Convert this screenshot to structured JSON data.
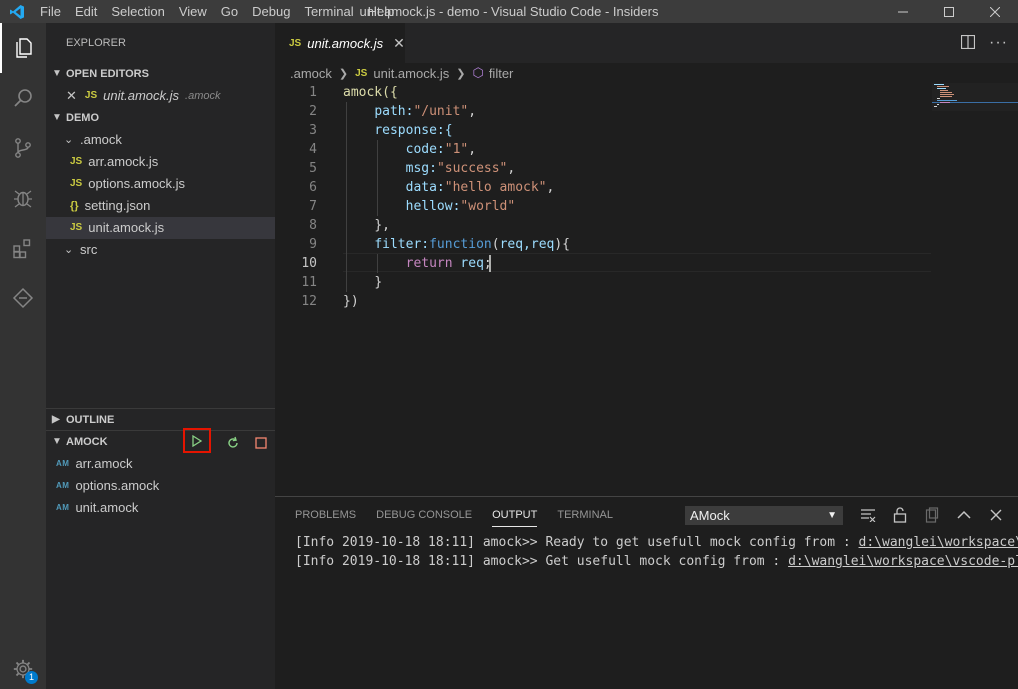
{
  "titlebar": {
    "menu": [
      "File",
      "Edit",
      "Selection",
      "View",
      "Go",
      "Debug",
      "Terminal",
      "Help"
    ],
    "window_title": "unit.amock.js - demo - Visual Studio Code - Insiders"
  },
  "activitybar": {
    "settings_badge": "1"
  },
  "sidebar": {
    "title": "EXPLORER",
    "open_editors": {
      "header": "OPEN EDITORS",
      "items": [
        {
          "icon": "JS",
          "name": "unit.amock.js",
          "path": ".amock"
        }
      ]
    },
    "demo": {
      "header": "DEMO",
      "folder": ".amock",
      "files": [
        {
          "icon": "JS",
          "name": "arr.amock.js"
        },
        {
          "icon": "JS",
          "name": "options.amock.js"
        },
        {
          "icon": "{}",
          "name": "setting.json"
        },
        {
          "icon": "JS",
          "name": "unit.amock.js"
        }
      ],
      "folder2": "src"
    },
    "outline": {
      "header": "OUTLINE"
    },
    "amock": {
      "header": "AMOCK",
      "items": [
        {
          "icon": "AM",
          "name": "arr.amock"
        },
        {
          "icon": "AM",
          "name": "options.amock"
        },
        {
          "icon": "AM",
          "name": "unit.amock"
        }
      ]
    }
  },
  "editor": {
    "tab": {
      "icon": "JS",
      "label": "unit.amock.js"
    },
    "breadcrumb": [
      ".amock",
      "unit.amock.js",
      "filter"
    ],
    "breadcrumb_icon": "JS",
    "line_numbers": [
      "1",
      "2",
      "3",
      "4",
      "5",
      "6",
      "7",
      "8",
      "9",
      "10",
      "11",
      "12"
    ],
    "current_line": "10",
    "code": {
      "l1": "amock({",
      "l2_key": "path:",
      "l2_val": "\"/unit\"",
      "l2_end": ",",
      "l3": "response:{",
      "l4_key": "code:",
      "l4_val": "\"1\"",
      "l4_end": ",",
      "l5_key": "msg:",
      "l5_val": "\"success\"",
      "l5_end": ",",
      "l6_key": "data:",
      "l6_val": "\"hello amock\"",
      "l6_end": ",",
      "l7_key": "hellow:",
      "l7_val": "\"world\"",
      "l8": "},",
      "l9_key": "filter:",
      "l9_kw": "function",
      "l9_open": "(",
      "l9_args": "req,req",
      "l9_close": "){",
      "l10_kw": "return",
      "l10_var": "req",
      "l10_end": ";",
      "l11": "}",
      "l12": "})"
    }
  },
  "panel": {
    "tabs": [
      "PROBLEMS",
      "DEBUG CONSOLE",
      "OUTPUT",
      "TERMINAL"
    ],
    "active_tab": "OUTPUT",
    "channel": "AMock",
    "lines": [
      {
        "prefix": "[Info 2019-10-18 18:11] amock>> Ready to get usefull mock config from : ",
        "link": "d:\\wanglei\\workspace\\v"
      },
      {
        "prefix": "[Info 2019-10-18 18:11] amock>> Get usefull mock config from : ",
        "link": "d:\\wanglei\\workspace\\vscode-plu"
      }
    ]
  },
  "colors": {
    "accent": "#007acc",
    "highlight_box": "#e51400",
    "run_green": "#89d185",
    "stop_orange": "#f48771"
  }
}
